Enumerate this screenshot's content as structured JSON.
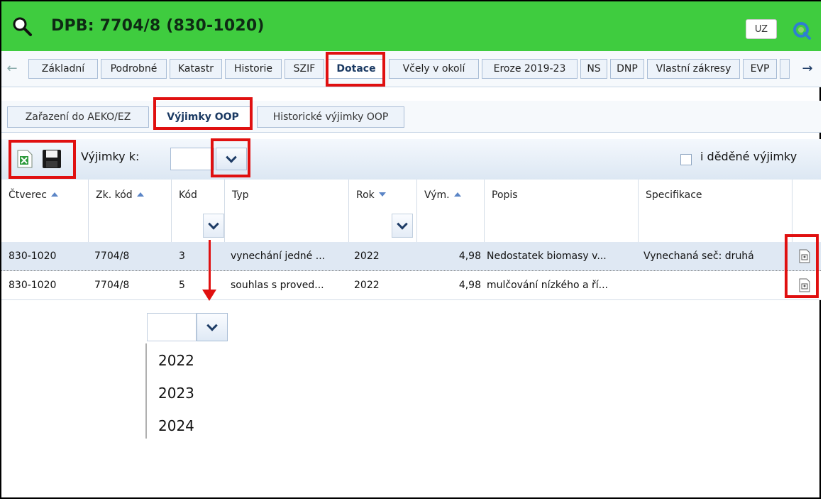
{
  "title": {
    "text": "DPB: 7704/8 (830-1020)",
    "user_button": "UZ"
  },
  "tabs": [
    {
      "label": "Základní"
    },
    {
      "label": "Podrobné"
    },
    {
      "label": "Katastr"
    },
    {
      "label": "Historie"
    },
    {
      "label": "SZIF"
    },
    {
      "label": "Dotace",
      "active": true
    },
    {
      "label": "Včely v okolí"
    },
    {
      "label": "Eroze 2019-23"
    },
    {
      "label": "NS"
    },
    {
      "label": "DNP"
    },
    {
      "label": "Vlastní zákresy"
    },
    {
      "label": "EVP"
    }
  ],
  "subtabs": [
    {
      "label": "Zařazení do AEKO/EZ"
    },
    {
      "label": "Výjimky OOP",
      "active": true
    },
    {
      "label": "Historické výjimky OOP"
    }
  ],
  "toolbar": {
    "exceptions_for_label": "Výjimky k:",
    "inherited_label": "i děděné výjimky"
  },
  "grid": {
    "columns": [
      "Čtverec",
      "Zk. kód",
      "Kód",
      "Typ",
      "Rok",
      "Vým.",
      "Popis",
      "Specifikace"
    ],
    "rows": [
      {
        "ctverec": "830-1020",
        "zk_kod": "7704/8",
        "kod": "3",
        "typ": "vynechání jedné ...",
        "rok": "2022",
        "vym": "4,98",
        "popis": "Nedostatek biomasy v...",
        "spec": "Vynechaná seč: druhá"
      },
      {
        "ctverec": "830-1020",
        "zk_kod": "7704/8",
        "kod": "5",
        "typ": "souhlas s proved...",
        "rok": "2022",
        "vym": "4,98",
        "popis": "mulčování nízkého a ří...",
        "spec": ""
      }
    ]
  },
  "dropdown": {
    "options": [
      "2022",
      "2023",
      "2024"
    ]
  },
  "colors": {
    "title_bar": "#3fcc3f",
    "highlight": "#e01010",
    "selected_row": "#dfe8f3"
  },
  "icons": [
    "search-icon",
    "refresh-icon",
    "excel-export-icon",
    "save-icon",
    "document-icon",
    "chevron-down-icon"
  ]
}
